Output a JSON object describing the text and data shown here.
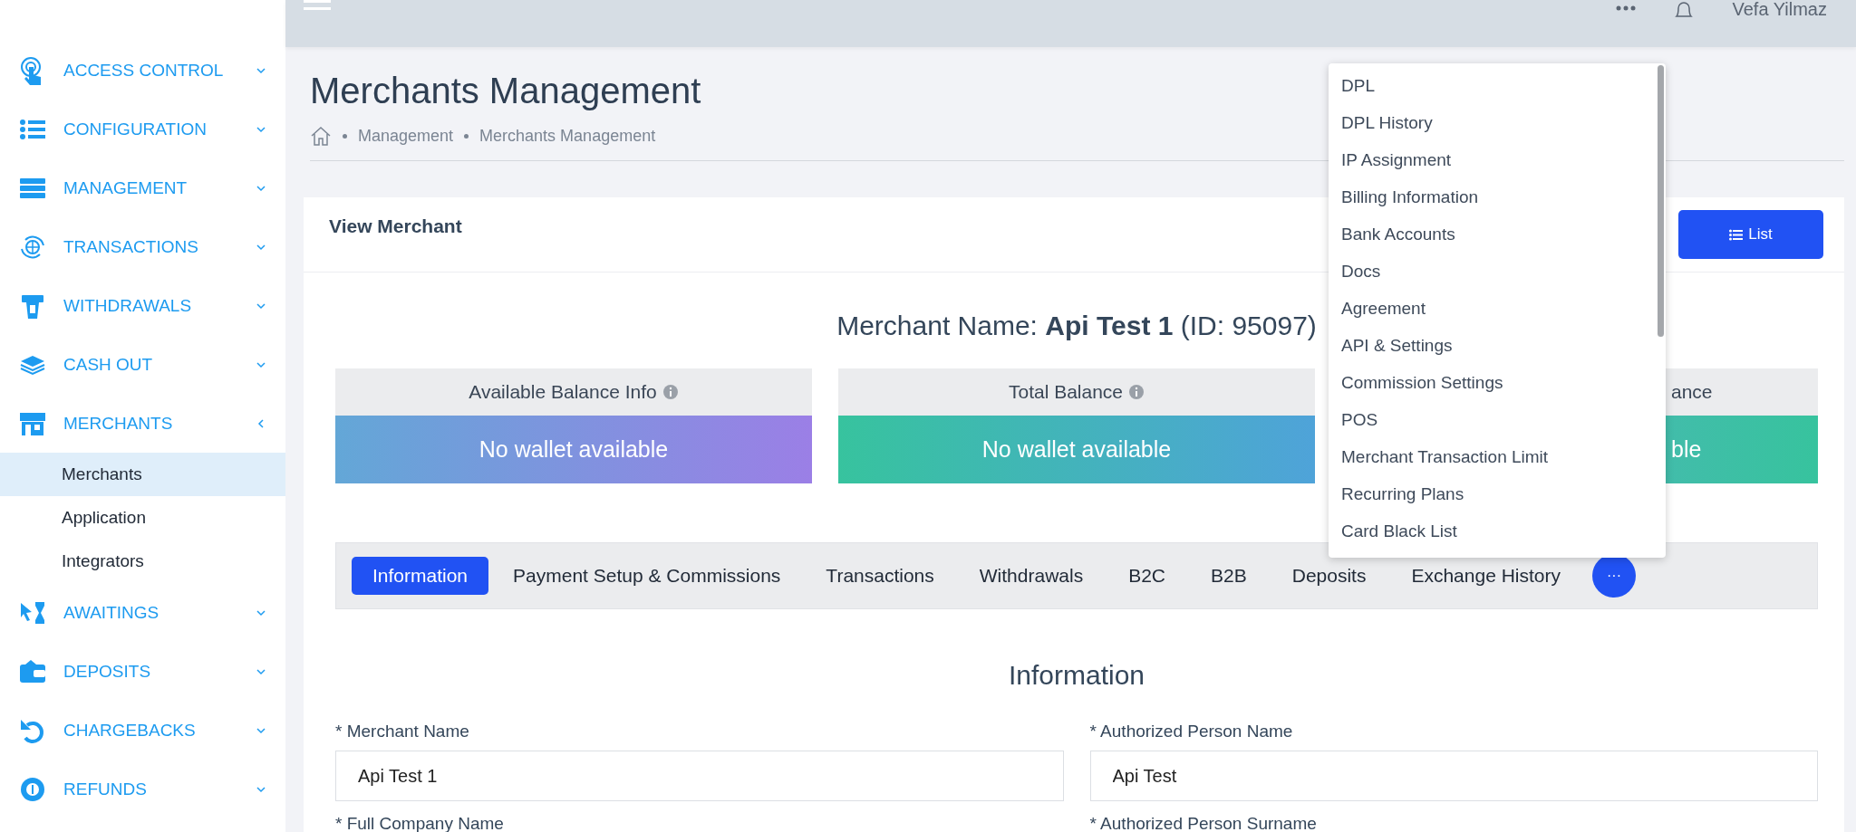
{
  "header": {
    "user_name": "Vefa Yilmaz"
  },
  "sidebar": {
    "items": [
      {
        "label": "ACCESS CONTROL",
        "expanded": false
      },
      {
        "label": "CONFIGURATION",
        "expanded": false
      },
      {
        "label": "MANAGEMENT",
        "expanded": false
      },
      {
        "label": "TRANSACTIONS",
        "expanded": false
      },
      {
        "label": "WITHDRAWALS",
        "expanded": false
      },
      {
        "label": "CASH OUT",
        "expanded": false
      },
      {
        "label": "MERCHANTS",
        "expanded": true,
        "children": [
          {
            "label": "Merchants",
            "selected": true
          },
          {
            "label": "Application",
            "selected": false
          },
          {
            "label": "Integrators",
            "selected": false
          }
        ]
      },
      {
        "label": "AWAITINGS",
        "expanded": false
      },
      {
        "label": "DEPOSITS",
        "expanded": false
      },
      {
        "label": "CHARGEBACKS",
        "expanded": false
      },
      {
        "label": "REFUNDS",
        "expanded": false
      }
    ]
  },
  "page": {
    "title": "Merchants Management",
    "breadcrumb": [
      "Management",
      "Merchants Management"
    ]
  },
  "card": {
    "title": "View Merchant",
    "list_button": "List",
    "merchant_line": "Merchant Name: **Api Test 1** (ID: 95097)",
    "balances": [
      {
        "title": "Available Balance Info",
        "info": true,
        "value": "No wallet available"
      },
      {
        "title": "Total Balance",
        "info": true,
        "value": "No wallet available"
      },
      {
        "title": "ance",
        "info": false,
        "value": "ble"
      }
    ],
    "tabs": [
      {
        "label": "Information",
        "selected": true
      },
      {
        "label": "Payment Setup & Commissions",
        "selected": false
      },
      {
        "label": "Transactions",
        "selected": false
      },
      {
        "label": "Withdrawals",
        "selected": false
      },
      {
        "label": "B2C",
        "selected": false
      },
      {
        "label": "B2B",
        "selected": false
      },
      {
        "label": "Deposits",
        "selected": false
      },
      {
        "label": "Exchange History",
        "selected": false
      }
    ],
    "more_button": "···",
    "section_title": "Information",
    "fields": [
      {
        "label": "* Merchant Name",
        "value": "Api Test 1"
      },
      {
        "label": "* Authorized Person Name",
        "value": "Api Test"
      },
      {
        "label": "* Full Company Name"
      },
      {
        "label": "* Authorized Person Surname"
      }
    ]
  },
  "dropdown": {
    "items": [
      "DPL",
      "DPL History",
      "IP Assignment",
      "Billing Information",
      "Bank Accounts",
      "Docs",
      "Agreement",
      "API & Settings",
      "Commission Settings",
      "POS",
      "Merchant Transaction Limit",
      "Recurring Plans",
      "Card Black List"
    ]
  }
}
